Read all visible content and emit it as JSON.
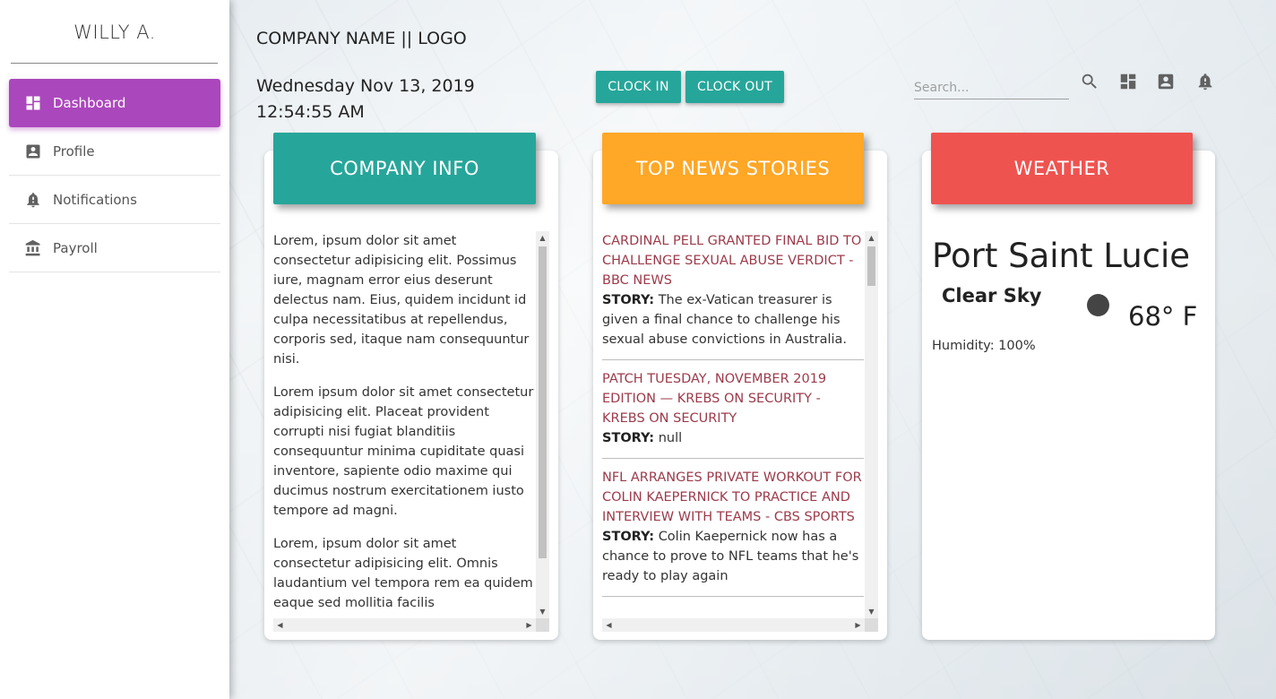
{
  "sidebar": {
    "user_name": "WILLY A.",
    "items": [
      {
        "label": "Dashboard",
        "icon": "dashboard-icon",
        "active": true
      },
      {
        "label": "Profile",
        "icon": "account-box-icon",
        "active": false
      },
      {
        "label": "Notifications",
        "icon": "notification-bell-icon",
        "active": false
      },
      {
        "label": "Payroll",
        "icon": "bank-icon",
        "active": false
      }
    ]
  },
  "header": {
    "company": "COMPANY NAME || LOGO",
    "date": "Wednesday Nov 13, 2019",
    "time": "12:54:55 AM",
    "clock_in": "CLOCK IN",
    "clock_out": "CLOCK OUT",
    "search_placeholder": "Search...",
    "icons": [
      "search-icon",
      "dashboard-icon",
      "account-box-icon",
      "notification-bell-icon"
    ]
  },
  "company_card": {
    "title": "COMPANY INFO",
    "paragraphs": [
      "Lorem, ipsum dolor sit amet consectetur adipisicing elit. Possimus iure, magnam error eius deserunt delectus nam. Eius, quidem incidunt id culpa necessitatibus at repellendus, corporis sed, itaque nam consequuntur nisi.",
      "Lorem ipsum dolor sit amet consectetur adipisicing elit. Placeat provident corrupti nisi fugiat blanditiis consequuntur minima cupiditate quasi inventore, sapiente odio maxime qui ducimus nostrum exercitationem iusto tempore ad magni.",
      "Lorem, ipsum dolor sit amet consectetur adipisicing elit. Omnis laudantium vel tempora rem ea quidem eaque sed mollitia facilis"
    ]
  },
  "news_card": {
    "title": "TOP NEWS STORIES",
    "story_label": "STORY:",
    "items": [
      {
        "headline": "Cardinal Pell granted final bid to challenge sexual abuse verdict - BBC News",
        "story": "The ex-Vatican treasurer is given a final chance to challenge his sexual abuse convictions in Australia."
      },
      {
        "headline": "Patch Tuesday, November 2019 Edition — Krebs on Security - Krebs on Security",
        "story": "null"
      },
      {
        "headline": "NFL arranges private workout for Colin Kaepernick to practice and interview with teams - CBS Sports",
        "story": "Colin Kaepernick now has a chance to prove to NFL teams that he's ready to play again"
      }
    ]
  },
  "weather_card": {
    "title": "WEATHER",
    "city": "Port Saint Lucie",
    "condition": "Clear Sky",
    "temperature": "68° F",
    "humidity": "Humidity: 100%"
  },
  "colors": {
    "sidebar_active": "#ab47bc",
    "button": "#26a69a",
    "company_header": "#26a69a",
    "news_header": "#ffa726",
    "weather_header": "#ef5350",
    "news_headline": "#9c3a4a"
  }
}
